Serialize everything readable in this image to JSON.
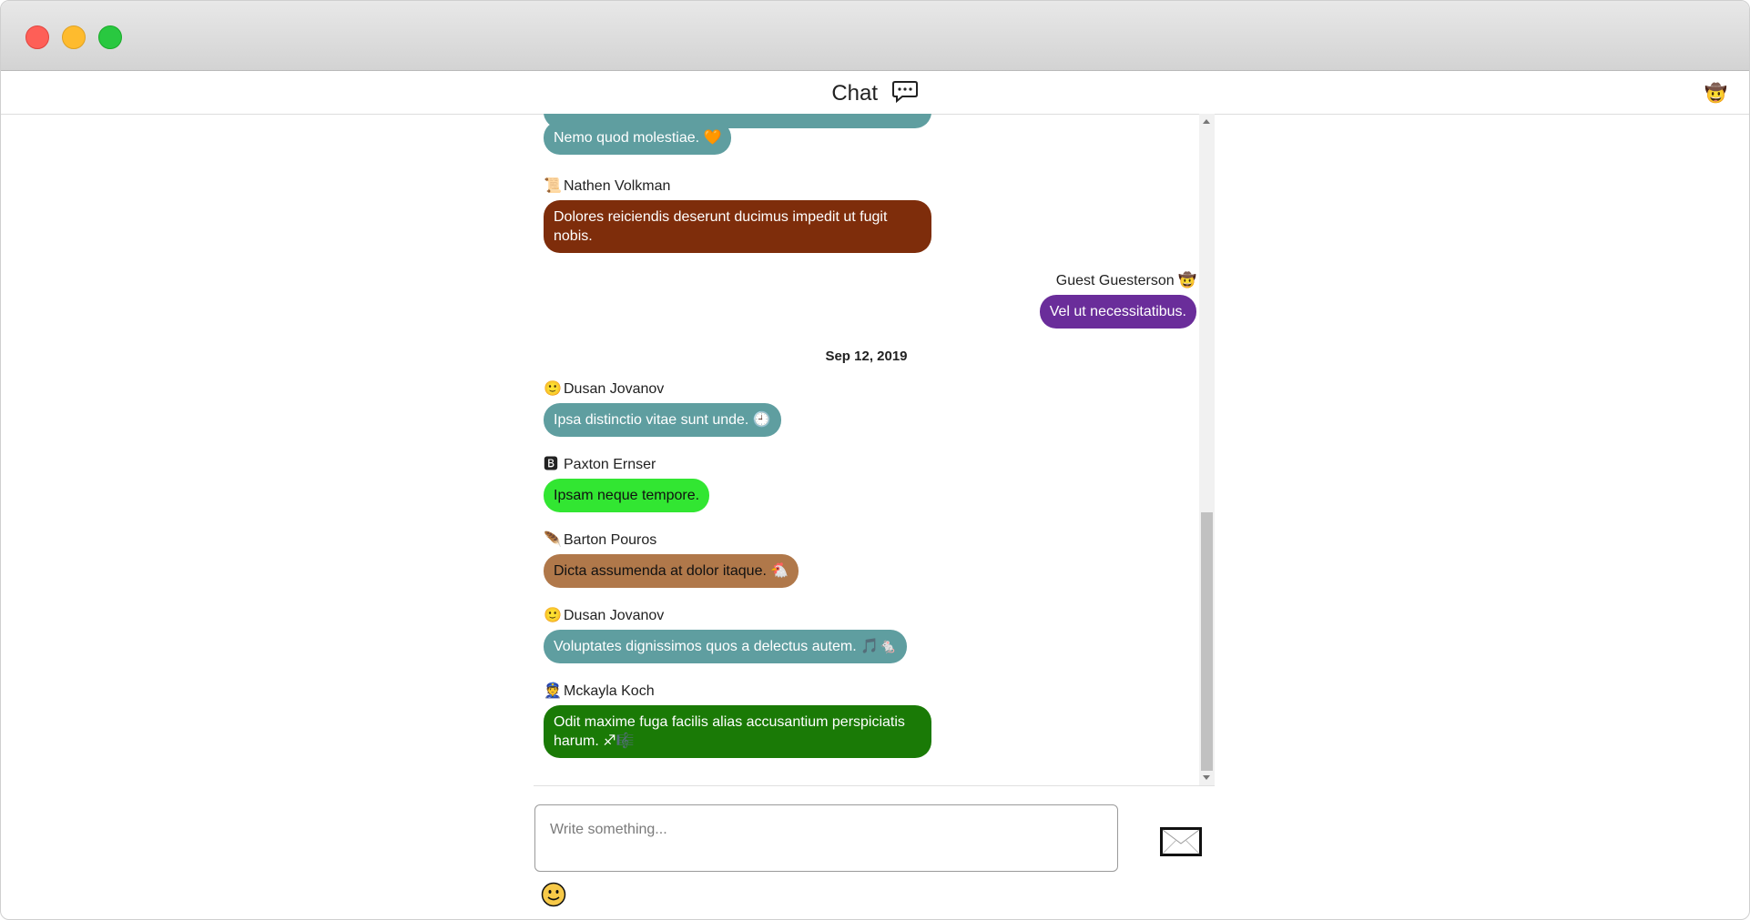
{
  "header": {
    "title": "Chat",
    "user_avatar": "🤠"
  },
  "messages": {
    "m0": {
      "text": "Nemo quod molestiae.",
      "trail": "🧡",
      "color": "#5f9ea0"
    },
    "m1": {
      "sender": "Nathen Volkman",
      "emoji": "📜",
      "text": "Dolores reiciendis deserunt ducimus impedit ut fugit nobis.",
      "color": "#7e2d0b"
    },
    "m2": {
      "sender": "Guest Guesterson",
      "emoji": "🤠",
      "text": "Vel ut necessitatibus.",
      "color": "#6a2d9a"
    },
    "date": "Sep 12, 2019",
    "m3": {
      "sender": "Dusan Jovanov",
      "emoji": "🙂",
      "text": "Ipsa distinctio vitae sunt unde.",
      "trail": "🕘",
      "color": "#5f9ea0"
    },
    "m4": {
      "sender": "Paxton Ernser",
      "emoji": "🅱",
      "text": "Ipsam neque tempore.",
      "color": "#32e632"
    },
    "m5": {
      "sender": "Barton Pouros",
      "emoji": "🪶",
      "text": "Dicta assumenda at dolor itaque.",
      "trail": "🐔",
      "color": "#b0784a"
    },
    "m6": {
      "sender": "Dusan Jovanov",
      "emoji": "🙂",
      "text": "Voluptates dignissimos quos a delectus autem.",
      "trail": "🎵🐁",
      "color": "#5f9ea0"
    },
    "m7": {
      "sender": "Mckayla Koch",
      "emoji": "👮",
      "text": "Odit maxime fuga facilis alias accusantium perspiciatis harum.",
      "trail": "♐🎼",
      "color": "#1a7a06"
    }
  },
  "composer": {
    "placeholder": "Write something...",
    "send_icon": "envelope-icon",
    "emoji_icon": "smiley-icon"
  }
}
